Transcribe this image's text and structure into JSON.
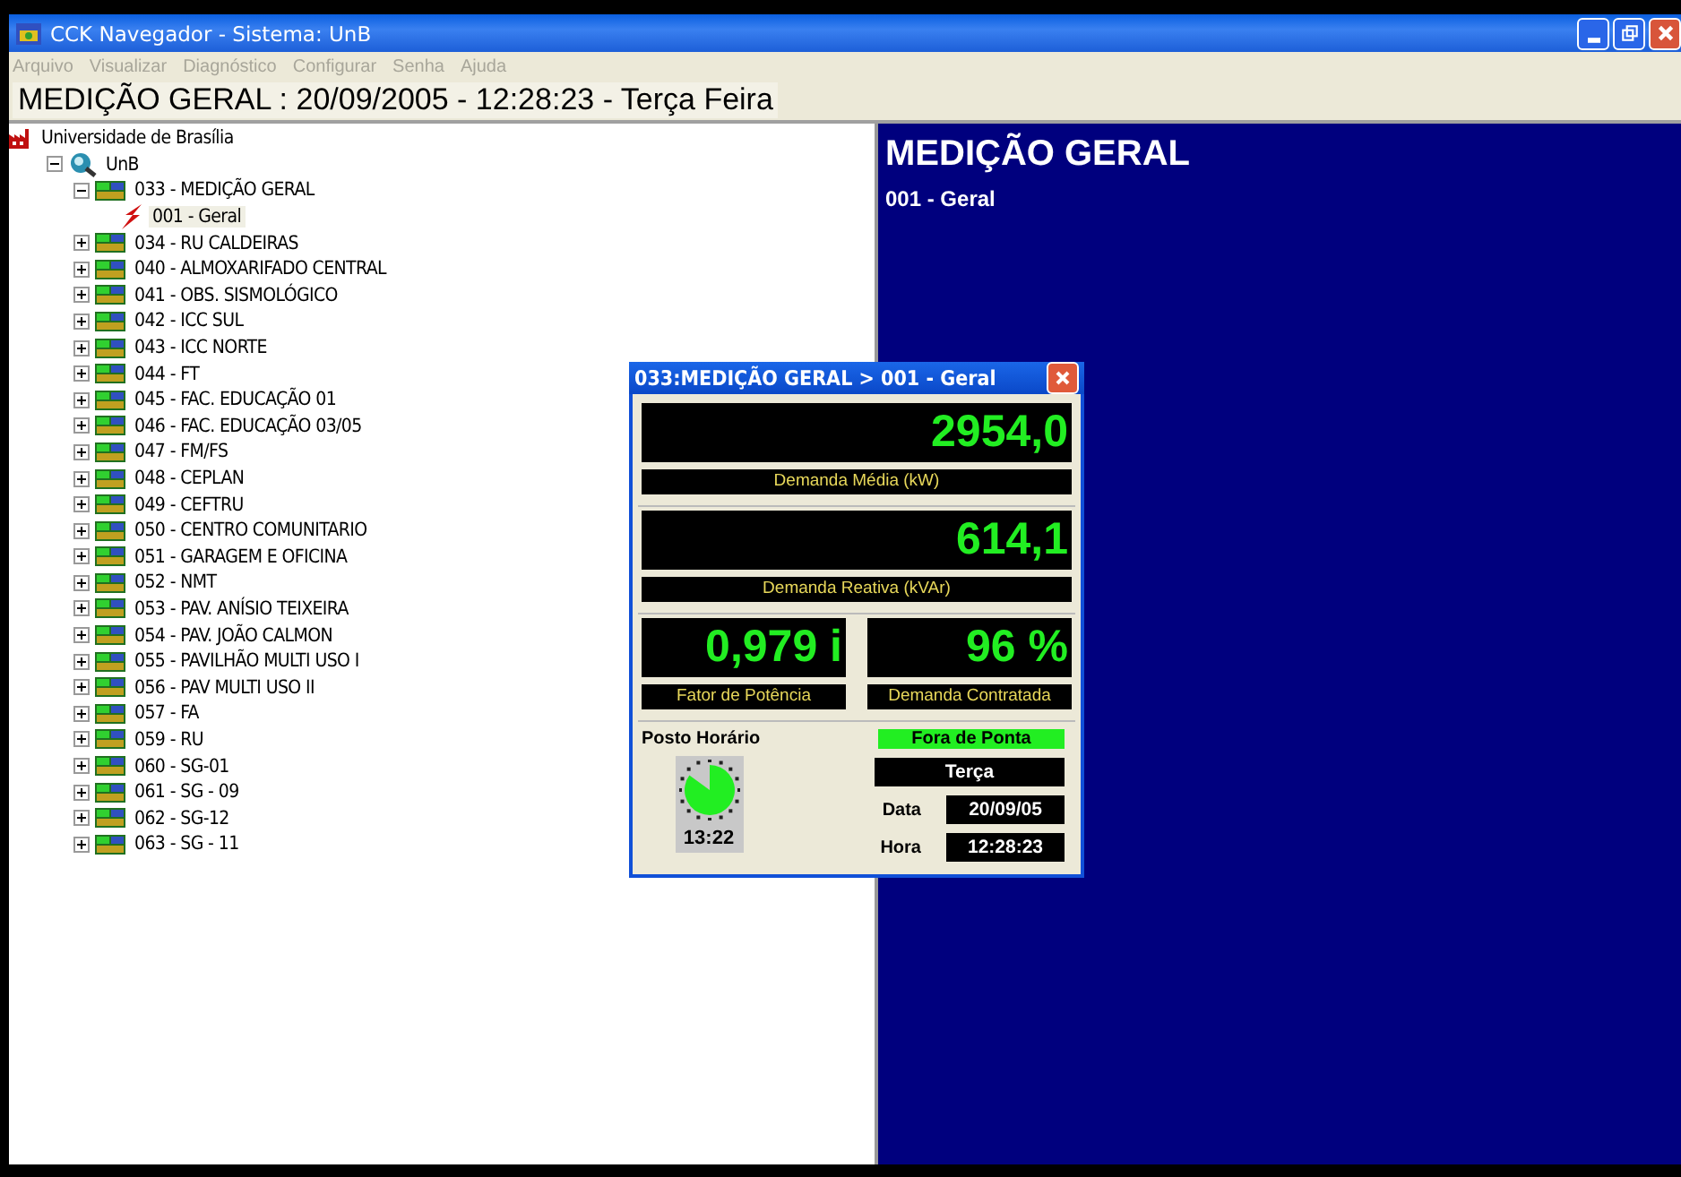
{
  "window": {
    "title": "CCK Navegador - Sistema: UnB"
  },
  "menu": [
    "Arquivo",
    "Visualizar",
    "Diagnóstico",
    "Configurar",
    "Senha",
    "Ajuda"
  ],
  "header": "MEDIÇÃO GERAL : 20/09/2005 - 12:28:23 - Terça Feira",
  "tree": [
    {
      "label": "Universidade de Brasília",
      "kind": "company",
      "children": [
        {
          "label": "UnB",
          "kind": "system",
          "expanded": true,
          "children": [
            {
              "label": "033 - MEDIÇÃO GERAL",
              "kind": "meter",
              "expanded": true,
              "children": [
                {
                  "label": "001 - Geral",
                  "kind": "point",
                  "selected": true
                }
              ]
            },
            {
              "label": "034 - RU CALDEIRAS",
              "kind": "meter",
              "expanded": false
            },
            {
              "label": "040 - ALMOXARIFADO CENTRAL",
              "kind": "meter",
              "expanded": false
            },
            {
              "label": "041 - OBS. SISMOLÓGICO",
              "kind": "meter",
              "expanded": false
            },
            {
              "label": "042 - ICC SUL",
              "kind": "meter",
              "expanded": false
            },
            {
              "label": "043 - ICC NORTE",
              "kind": "meter",
              "expanded": false
            },
            {
              "label": "044 - FT",
              "kind": "meter",
              "expanded": false
            },
            {
              "label": "045 - FAC. EDUCAÇÃO 01",
              "kind": "meter",
              "expanded": false
            },
            {
              "label": "046 - FAC. EDUCAÇÃO 03/05",
              "kind": "meter",
              "expanded": false
            },
            {
              "label": "047 - FM/FS",
              "kind": "meter",
              "expanded": false
            },
            {
              "label": "048 - CEPLAN",
              "kind": "meter",
              "expanded": false
            },
            {
              "label": "049 - CEFTRU",
              "kind": "meter",
              "expanded": false
            },
            {
              "label": "050 - CENTRO COMUNITARIO",
              "kind": "meter",
              "expanded": false
            },
            {
              "label": "051 - GARAGEM E OFICINA",
              "kind": "meter",
              "expanded": false
            },
            {
              "label": "052 - NMT",
              "kind": "meter",
              "expanded": false
            },
            {
              "label": "053 - PAV. ANÍSIO TEIXEIRA",
              "kind": "meter",
              "expanded": false
            },
            {
              "label": "054 - PAV. JOÃO CALMON",
              "kind": "meter",
              "expanded": false
            },
            {
              "label": "055 - PAVILHÃO MULTI USO I",
              "kind": "meter",
              "expanded": false
            },
            {
              "label": "056 - PAV MULTI USO II",
              "kind": "meter",
              "expanded": false
            },
            {
              "label": "057 - FA",
              "kind": "meter",
              "expanded": false
            },
            {
              "label": "059 - RU",
              "kind": "meter",
              "expanded": false
            },
            {
              "label": "060 - SG-01",
              "kind": "meter",
              "expanded": false
            },
            {
              "label": "061 - SG - 09",
              "kind": "meter",
              "expanded": false
            },
            {
              "label": "062 - SG-12",
              "kind": "meter",
              "expanded": false
            },
            {
              "label": "063 - SG - 11",
              "kind": "meter",
              "expanded": false
            }
          ]
        }
      ]
    }
  ],
  "detail": {
    "title": "MEDIÇÃO GERAL",
    "subtitle": "001 - Geral"
  },
  "popup": {
    "title": "033:MEDIÇÃO GERAL > 001 - Geral",
    "readings": [
      {
        "value": "2954,0",
        "label": "Demanda Média (kW)",
        "kind": "wide"
      },
      {
        "value": "614,1",
        "label": "Demanda Reativa (kVAr)",
        "kind": "wide"
      },
      {
        "value": "0,979 i",
        "label": "Fator de Potência",
        "kind": "half"
      },
      {
        "value": "96 %",
        "label": "Demanda Contratada",
        "kind": "half"
      }
    ],
    "posto_label": "Posto Horário",
    "posto": "Fora de Ponta",
    "posto_on": true,
    "day": "Terça",
    "clock": {
      "time": "13:22"
    },
    "fields": [
      {
        "label": "Data",
        "value": "20/09/05"
      },
      {
        "label": "Hora",
        "value": "12:28:23"
      }
    ]
  }
}
